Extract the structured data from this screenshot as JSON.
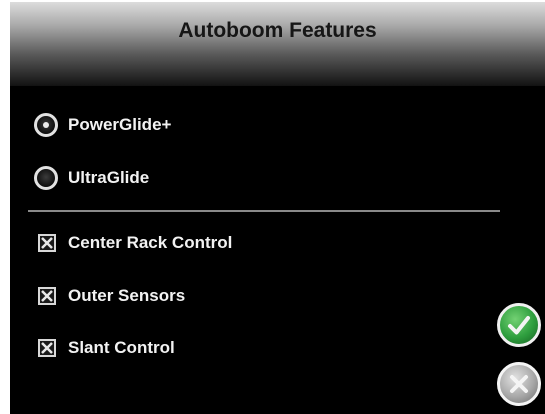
{
  "dialog": {
    "title": "Autoboom Features"
  },
  "modes": [
    {
      "label": "PowerGlide+",
      "selected": true
    },
    {
      "label": "UltraGlide",
      "selected": false
    }
  ],
  "features": [
    {
      "label": "Center Rack Control",
      "checked": true
    },
    {
      "label": "Outer Sensors",
      "checked": true
    },
    {
      "label": "Slant Control",
      "checked": true
    }
  ],
  "colors": {
    "accept": "#2e9e3e",
    "cancel": "#a8a8a8",
    "background": "#000000"
  },
  "icons": {
    "accept": "checkmark-icon",
    "cancel": "x-icon"
  }
}
